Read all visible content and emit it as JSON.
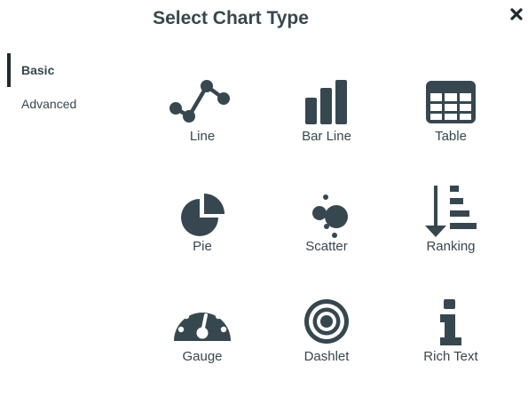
{
  "dialog": {
    "title": "Select Chart Type",
    "close_icon": "close-icon"
  },
  "sidebar": {
    "items": [
      {
        "label": "Basic",
        "active": true
      },
      {
        "label": "Advanced",
        "active": false
      }
    ]
  },
  "chart_types": [
    {
      "label": "Line",
      "icon": "line-chart-icon"
    },
    {
      "label": "Bar Line",
      "icon": "bar-chart-icon"
    },
    {
      "label": "Table",
      "icon": "table-icon"
    },
    {
      "label": "Pie",
      "icon": "pie-chart-icon"
    },
    {
      "label": "Scatter",
      "icon": "scatter-chart-icon"
    },
    {
      "label": "Ranking",
      "icon": "ranking-icon"
    },
    {
      "label": "Gauge",
      "icon": "gauge-icon"
    },
    {
      "label": "Dashlet",
      "icon": "dashlet-icon"
    },
    {
      "label": "Rich Text",
      "icon": "info-icon"
    }
  ],
  "colors": {
    "icon": "#37474f",
    "text": "#37474f",
    "active_bar": "#1f2a30"
  }
}
